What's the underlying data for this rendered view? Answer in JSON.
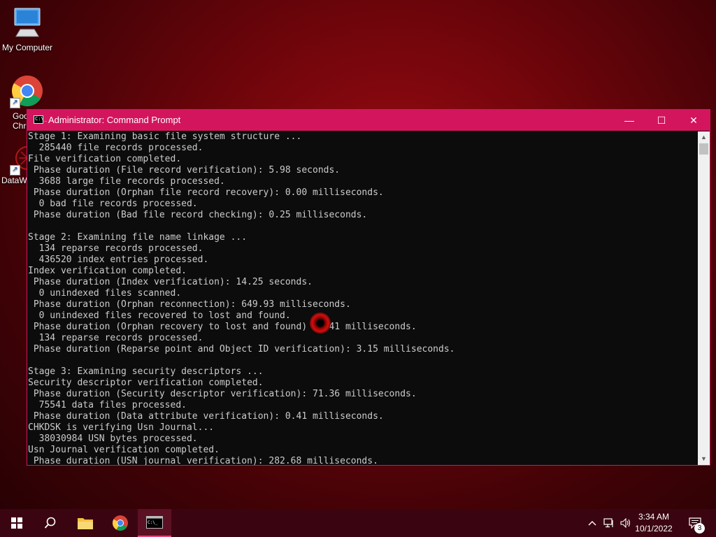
{
  "desktop": {
    "icons": [
      {
        "label": "My Computer"
      },
      {
        "label": "Goo\nChr"
      },
      {
        "label": "DataW"
      }
    ]
  },
  "window": {
    "title": "Administrator: Command Prompt",
    "icon_text": "C:\\_",
    "controls": {
      "minimize": "—",
      "maximize": "☐",
      "close": "✕"
    }
  },
  "terminal": {
    "lines": [
      "Stage 1: Examining basic file system structure ...",
      "  285440 file records processed.",
      "File verification completed.",
      " Phase duration (File record verification): 5.98 seconds.",
      "  3688 large file records processed.",
      " Phase duration (Orphan file record recovery): 0.00 milliseconds.",
      "  0 bad file records processed.",
      " Phase duration (Bad file record checking): 0.25 milliseconds.",
      "",
      "Stage 2: Examining file name linkage ...",
      "  134 reparse records processed.",
      "  436520 index entries processed.",
      "Index verification completed.",
      " Phase duration (Index verification): 14.25 seconds.",
      "  0 unindexed files scanned.",
      " Phase duration (Orphan reconnection): 649.93 milliseconds.",
      "  0 unindexed files recovered to lost and found.",
      " Phase duration (Orphan recovery to lost and found)   .41 milliseconds.",
      "  134 reparse records processed.",
      " Phase duration (Reparse point and Object ID verification): 3.15 milliseconds.",
      "",
      "Stage 3: Examining security descriptors ...",
      "Security descriptor verification completed.",
      " Phase duration (Security descriptor verification): 71.36 milliseconds.",
      "  75541 data files processed.",
      " Phase duration (Data attribute verification): 0.41 milliseconds.",
      "CHKDSK is verifying Usn Journal...",
      "  38030984 USN bytes processed.",
      "Usn Journal verification completed.",
      " Phase duration (USN journal verification): 282.68 milliseconds."
    ]
  },
  "taskbar": {
    "clock_time": "3:34 AM",
    "clock_date": "10/1/2022",
    "notification_count": "3"
  },
  "colors": {
    "accent": "#d3155e",
    "terminal_bg": "#0c0c0c",
    "terminal_fg": "#cccccc",
    "taskbar_bg": "#3a0510"
  }
}
